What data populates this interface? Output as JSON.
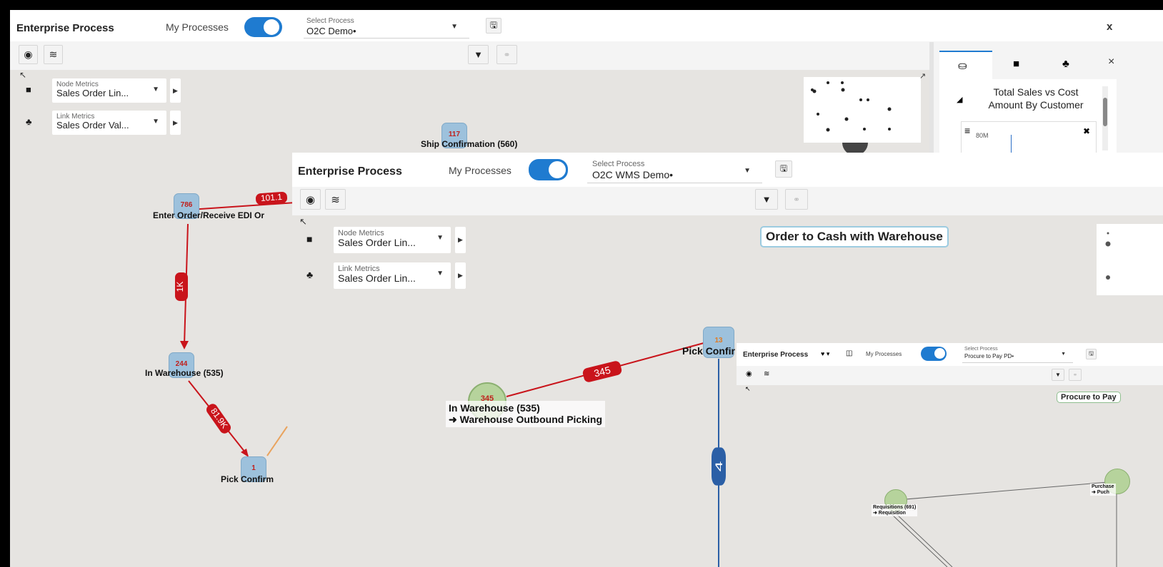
{
  "window1": {
    "title": "Enterprise Process",
    "my_processes_label": "My Processes",
    "my_processes_on": true,
    "select_caption": "Select Process",
    "select_value": "O2C Demo•",
    "close": "x",
    "node_metrics": {
      "caption": "Node Metrics",
      "value": "Sales Order Lin..."
    },
    "link_metrics": {
      "caption": "Link Metrics",
      "value": "Sales Order Val..."
    },
    "nodes": [
      {
        "count": "117",
        "label": "Ship Confirmation (560)"
      },
      {
        "count": "786",
        "label": "Enter Order/Receive EDI Or"
      },
      {
        "count": "244",
        "label": "In Warehouse (535)"
      },
      {
        "count": "1",
        "label": "Pick Confirm"
      }
    ],
    "edges": [
      "101.1",
      "1K",
      "81.9K"
    ],
    "side_panel": {
      "close": "×",
      "chart_title": "Total Sales vs Cost Amount By Customer",
      "axis_tick": "80M"
    }
  },
  "window2": {
    "title": "Enterprise Process",
    "my_processes_label": "My Processes",
    "my_processes_on": true,
    "select_caption": "Select Process",
    "select_value": "O2C WMS Demo•",
    "process_title": "Order to Cash with Warehouse",
    "node_metrics": {
      "caption": "Node Metrics",
      "value": "Sales Order Lin..."
    },
    "link_metrics": {
      "caption": "Link Metrics",
      "value": "Sales Order Lin..."
    },
    "nodes": [
      {
        "count": "345",
        "label": "In Warehouse (535)",
        "sublabel": "➜ Warehouse Outbound Picking"
      },
      {
        "count": "13",
        "label": "Pick Confir"
      }
    ],
    "edges": [
      "345",
      "4"
    ]
  },
  "window3": {
    "title": "Enterprise Process",
    "my_processes_label": "My Processes",
    "my_processes_on": true,
    "select_caption": "Select Process",
    "select_value": "Procure to Pay PD•",
    "process_title": "Procure to Pay",
    "nodes": [
      {
        "label": "Requisitions (691)",
        "sublabel": "➜ Requisition"
      },
      {
        "label": "Purchase",
        "sublabel": "➜ Puch"
      }
    ]
  },
  "colors": {
    "toggle": "#1f7bd0",
    "edge": "#c9141b",
    "edge_blue": "#2b5fa6",
    "node_square": "#9dc1dc",
    "node_circle": "#b6d39c"
  }
}
